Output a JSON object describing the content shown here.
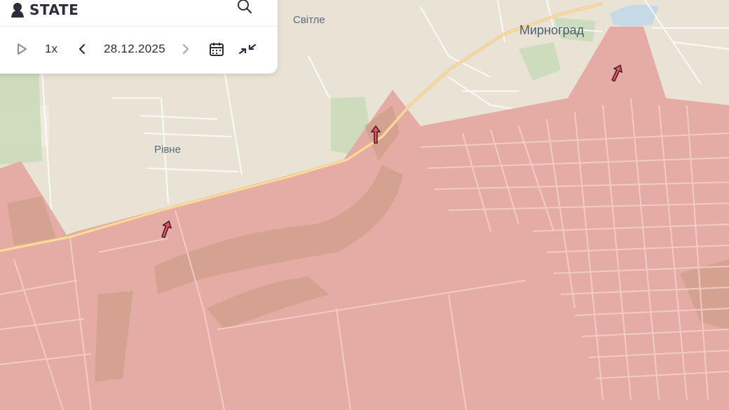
{
  "map": {
    "places": [
      {
        "name": "Світле",
        "kind": "town"
      },
      {
        "name": "Мирноград",
        "kind": "city"
      },
      {
        "name": "Рівне",
        "kind": "town"
      }
    ],
    "colors": {
      "background": "#e9e3d6",
      "occupied": "#e3a79f",
      "road": "#f4c886",
      "green": "#c9dbb8"
    },
    "markers": [
      {
        "icon": "attack-arrow-icon"
      },
      {
        "icon": "attack-arrow-icon"
      },
      {
        "icon": "attack-arrow-icon"
      }
    ]
  },
  "header": {
    "brand_text": "STATE",
    "brand_icon": "person-silhouette-icon",
    "search_icon": "search-icon"
  },
  "timeline": {
    "play_icon": "play-icon",
    "speed": "1x",
    "prev_icon": "chevron-left-icon",
    "date": "28.12.2025",
    "next_icon": "chevron-right-icon",
    "calendar_icon": "calendar-icon",
    "compare_icon": "collapse-arrows-icon"
  }
}
